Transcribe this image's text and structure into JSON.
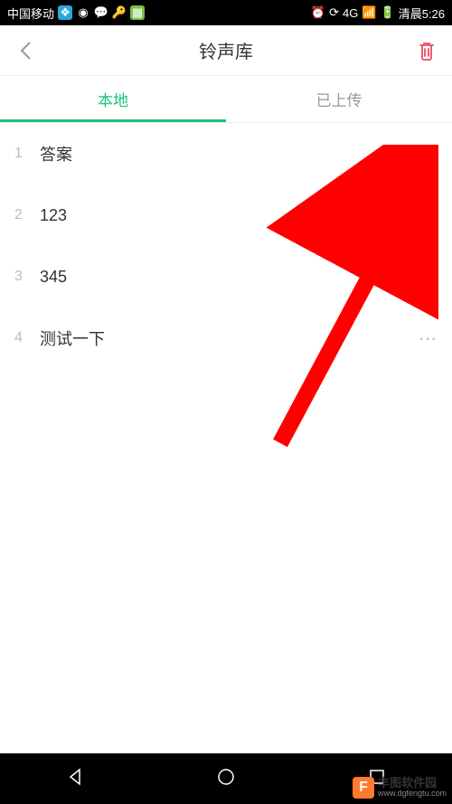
{
  "status_bar": {
    "carrier": "中国移动",
    "time": "清晨5:26",
    "network": "4G"
  },
  "header": {
    "title": "铃声库"
  },
  "tabs": {
    "local": "本地",
    "uploaded": "已上传",
    "active": 0
  },
  "list": {
    "items": [
      {
        "index": "1",
        "title": "答案"
      },
      {
        "index": "2",
        "title": "123"
      },
      {
        "index": "3",
        "title": "345"
      },
      {
        "index": "4",
        "title": "测试一下"
      }
    ]
  },
  "watermark": {
    "name": "丰图软件园",
    "url": "www.dgfengtu.com",
    "icon_letter": "F"
  }
}
